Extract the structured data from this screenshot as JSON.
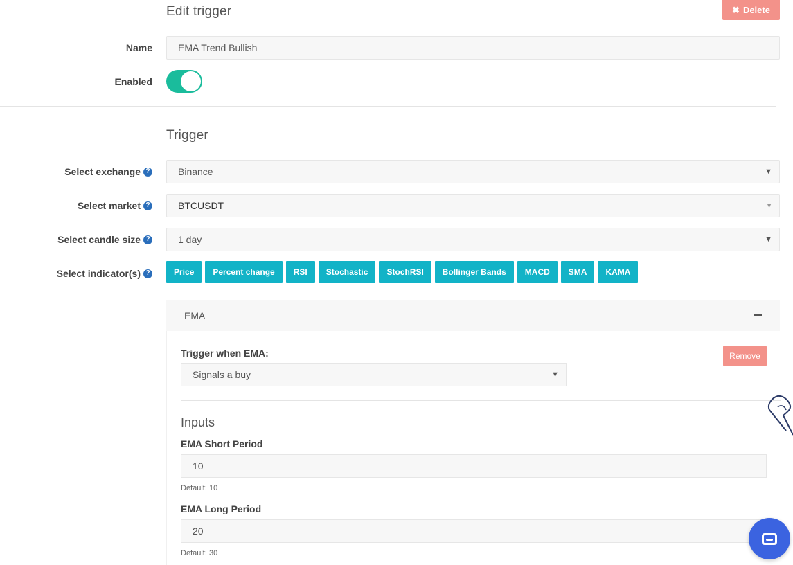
{
  "header": {
    "title": "Edit trigger",
    "delete_icon": "✖",
    "delete_label": "Delete"
  },
  "general": {
    "name_label": "Name",
    "name_value": "EMA Trend Bullish",
    "enabled_label": "Enabled",
    "enabled": true
  },
  "trigger": {
    "title": "Trigger",
    "exchange_label": "Select exchange",
    "exchange_value": "Binance",
    "market_label": "Select market",
    "market_value": "BTCUSDT",
    "candle_label": "Select candle size",
    "candle_value": "1 day",
    "indicators_label": "Select indicator(s)",
    "indicators": [
      "Price",
      "Percent change",
      "RSI",
      "Stochastic",
      "StochRSI",
      "Bollinger Bands",
      "MACD",
      "SMA",
      "KAMA"
    ],
    "help_icon": "?"
  },
  "ema_panel": {
    "title": "EMA",
    "trigger_when_label": "Trigger when EMA:",
    "trigger_when_value": "Signals a buy",
    "remove_label": "Remove",
    "inputs_title": "Inputs",
    "short_label": "EMA Short Period",
    "short_value": "10",
    "short_default": "Default: 10",
    "long_label": "EMA Long Period",
    "long_value": "20",
    "long_default": "Default: 30"
  },
  "colors": {
    "accent": "#12b3c7",
    "toggle_on": "#1abc9c",
    "danger": "#f3928a",
    "chat": "#3b63e0"
  }
}
